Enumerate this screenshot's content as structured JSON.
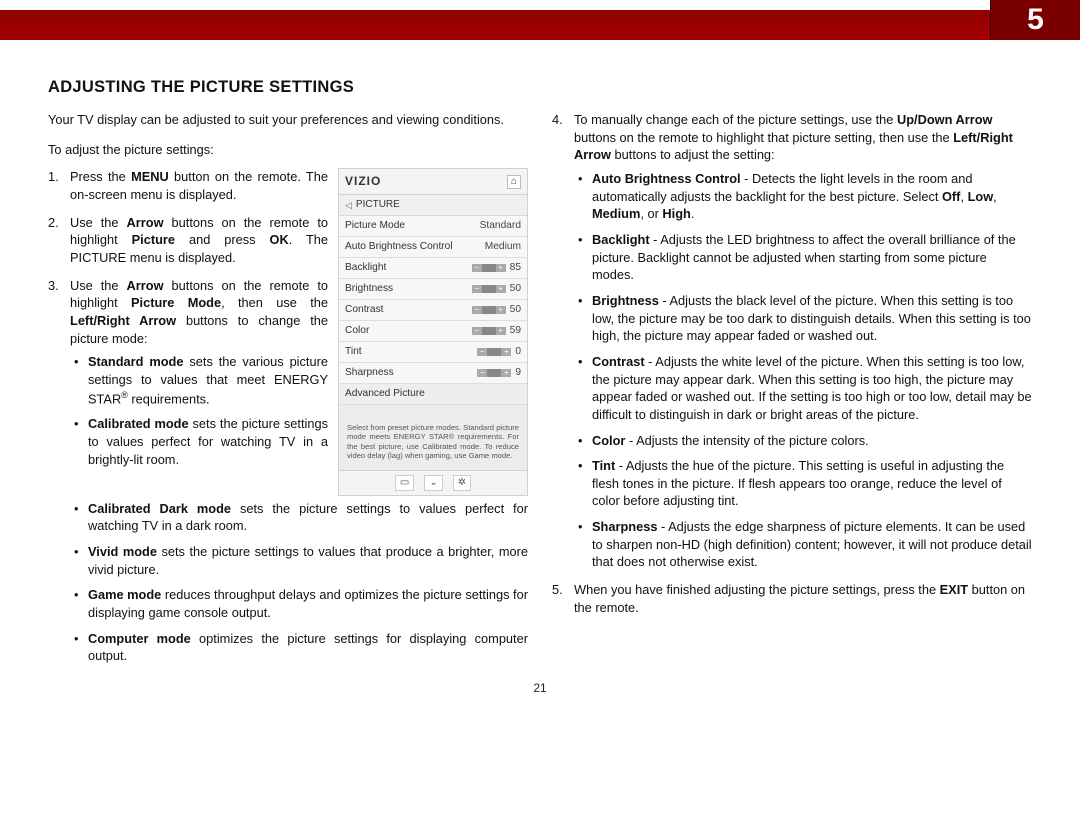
{
  "chapter_number": "5",
  "heading": "ADJUSTING THE PICTURE SETTINGS",
  "intro": "Your TV display can be adjusted to suit your preferences and viewing conditions.",
  "lead": "To adjust the picture settings:",
  "steps_left": {
    "s1": {
      "pre": "Press the ",
      "b1": "MENU",
      "post": " button on the remote. The on-screen menu is displayed."
    },
    "s2": {
      "pre": "Use the ",
      "b1": "Arrow",
      "mid1": " buttons on the remote to highlight ",
      "b2": "Picture",
      "mid2": " and press ",
      "b3": "OK",
      "post": ". The PICTURE menu is displayed."
    },
    "s3": {
      "pre": "Use the ",
      "b1": "Arrow",
      "mid1": " buttons on the remote to highlight ",
      "b2": "Picture Mode",
      "mid2": ", then use the ",
      "b3": "Left/Right Arrow",
      "post": " buttons to change the picture mode:"
    },
    "modes": {
      "std": {
        "b": "Standard mode",
        "t": " sets the various picture settings to values that meet ENERGY STAR",
        "sup": "®",
        "t2": " requirements."
      },
      "cal": {
        "b": "Calibrated mode",
        "t": " sets the picture settings to values perfect for watching TV in a brightly-lit room."
      },
      "dark": {
        "b": "Calibrated Dark mode",
        "t": " sets the picture settings to values perfect for watching TV in a dark room."
      },
      "vivid": {
        "b": "Vivid mode",
        "t": " sets the picture settings to values that produce a brighter, more vivid picture."
      },
      "game": {
        "b": "Game mode",
        "t": " reduces throughput delays and optimizes the picture settings for displaying game console output."
      },
      "comp": {
        "b": "Computer mode",
        "t": " optimizes the picture settings for displaying computer output."
      }
    }
  },
  "steps_right": {
    "s4": {
      "pre": "To manually change each of the picture settings, use the ",
      "b1": "Up/Down Arrow",
      "mid1": " buttons on the remote to highlight that picture setting, then use the ",
      "b2": "Left/Right Arrow",
      "post": " buttons to adjust the setting:"
    },
    "settings": {
      "abc": {
        "b": "Auto Brightness Control",
        "t": " - Detects the light levels in the room and automatically adjusts the backlight for the best picture. Select ",
        "o1": "Off",
        "c1": ", ",
        "o2": "Low",
        "c2": ", ",
        "o3": "Medium",
        "c3": ", or ",
        "o4": "High",
        "c4": "."
      },
      "backlight": {
        "b": "Backlight",
        "t": " - Adjusts the LED brightness to affect the overall brilliance of the picture. Backlight cannot be adjusted when starting from some picture modes."
      },
      "brightness": {
        "b": "Brightness",
        "t": " - Adjusts the black level of the picture. When this setting is too low, the picture may be too dark to distinguish details. When this setting is too high, the picture may appear faded or washed out."
      },
      "contrast": {
        "b": "Contrast",
        "t": " - Adjusts the white level of the picture. When this setting is too low, the picture may appear dark. When this setting is too high, the picture may appear faded or washed out. If the setting is too high or too low, detail may be difficult to distinguish in dark or bright areas of the picture."
      },
      "color": {
        "b": "Color",
        "t": " - Adjusts the intensity of the picture colors."
      },
      "tint": {
        "b": "Tint",
        "t": " - Adjusts the hue of the picture. This setting is useful in adjusting the flesh tones in the picture. If flesh appears too orange, reduce the level of color before adjusting tint."
      },
      "sharp": {
        "b": "Sharpness",
        "t": " - Adjusts the edge sharpness of picture elements. It can be used to sharpen non-HD (high definition) content; however, it will not produce detail that does not otherwise exist."
      }
    },
    "s5": {
      "pre": "When you have finished adjusting the picture settings, press the ",
      "b1": "EXIT",
      "post": " button on the remote."
    }
  },
  "osd": {
    "logo": "VIZIO",
    "home": "⌂",
    "crumb_arrow": "◁",
    "crumb": "PICTURE",
    "rows": {
      "mode": {
        "label": "Picture Mode",
        "val": "Standard"
      },
      "abc": {
        "label": "Auto Brightness Control",
        "val": "Medium"
      },
      "back": {
        "label": "Backlight",
        "val": "85"
      },
      "bri": {
        "label": "Brightness",
        "val": "50"
      },
      "con": {
        "label": "Contrast",
        "val": "50"
      },
      "col": {
        "label": "Color",
        "val": "59"
      },
      "tint": {
        "label": "Tint",
        "val": "0"
      },
      "sharp": {
        "label": "Sharpness",
        "val": "9"
      }
    },
    "adv": "Advanced Picture",
    "help": "Select from preset picture modes. Standard picture mode meets ENERGY STAR® requirements. For the best picture, use Calibrated mode. To reduce video delay (lag) when gaming, use Game mode.",
    "footer": {
      "a": "▭",
      "b": "⌄",
      "c": "✲"
    }
  },
  "footer_page": "21"
}
